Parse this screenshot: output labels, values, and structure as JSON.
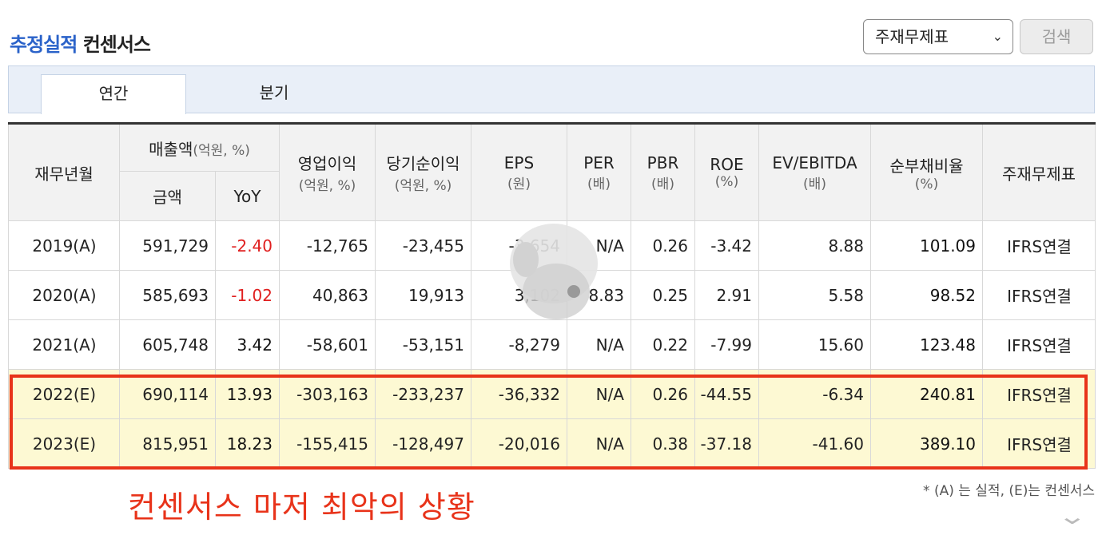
{
  "header": {
    "title_accent": "추정실적",
    "title_rest": "컨센서스",
    "select_value": "주재무제표",
    "search_label": "검색"
  },
  "tabs": [
    "연간",
    "분기"
  ],
  "table": {
    "col_period": "재무년월",
    "col_revenue": "매출액",
    "col_revenue_unit": "(억원, %)",
    "col_amount": "금액",
    "col_yoy": "YoY",
    "col_op": "영업이익",
    "col_op_unit": "(억원, %)",
    "col_net": "당기순이익",
    "col_net_unit": "(억원, %)",
    "col_eps": "EPS",
    "col_eps_unit": "(원)",
    "col_per": "PER",
    "col_per_unit": "(배)",
    "col_pbr": "PBR",
    "col_pbr_unit": "(배)",
    "col_roe": "ROE",
    "col_roe_unit": "(%)",
    "col_ev": "EV/EBITDA",
    "col_ev_unit": "(배)",
    "col_debt": "순부채비율",
    "col_debt_unit": "(%)",
    "col_basis": "주재무제표",
    "rows": [
      {
        "period": "2019(A)",
        "amount": "591,729",
        "yoy": "-2.40",
        "op": "-12,765",
        "net": "-23,455",
        "eps": "-3,654",
        "per": "N/A",
        "pbr": "0.26",
        "roe": "-3.42",
        "ev": "8.88",
        "debt": "101.09",
        "basis": "IFRS연결"
      },
      {
        "period": "2020(A)",
        "amount": "585,693",
        "yoy": "-1.02",
        "op": "40,863",
        "net": "19,913",
        "eps": "3,102",
        "per": "8.83",
        "pbr": "0.25",
        "roe": "2.91",
        "ev": "5.58",
        "debt": "98.52",
        "basis": "IFRS연결"
      },
      {
        "period": "2021(A)",
        "amount": "605,748",
        "yoy": "3.42",
        "op": "-58,601",
        "net": "-53,151",
        "eps": "-8,279",
        "per": "N/A",
        "pbr": "0.22",
        "roe": "-7.99",
        "ev": "15.60",
        "debt": "123.48",
        "basis": "IFRS연결"
      },
      {
        "period": "2022(E)",
        "amount": "690,114",
        "yoy": "13.93",
        "op": "-303,163",
        "net": "-233,237",
        "eps": "-36,332",
        "per": "N/A",
        "pbr": "0.26",
        "roe": "-44.55",
        "ev": "-6.34",
        "debt": "240.81",
        "basis": "IFRS연결"
      },
      {
        "period": "2023(E)",
        "amount": "815,951",
        "yoy": "18.23",
        "op": "-155,415",
        "net": "-128,497",
        "eps": "-20,016",
        "per": "N/A",
        "pbr": "0.38",
        "roe": "-37.18",
        "ev": "-41.60",
        "debt": "389.10",
        "basis": "IFRS연결"
      }
    ]
  },
  "annotation": "컨센서스 마저 최악의 상황",
  "footnote": "* (A) 는 실적, (E)는 컨센서스",
  "colors": {
    "accent": "#2a62c9",
    "negative": "#e02020",
    "highlight": "#e8331a",
    "estimate_row": "#fdf9d3"
  }
}
